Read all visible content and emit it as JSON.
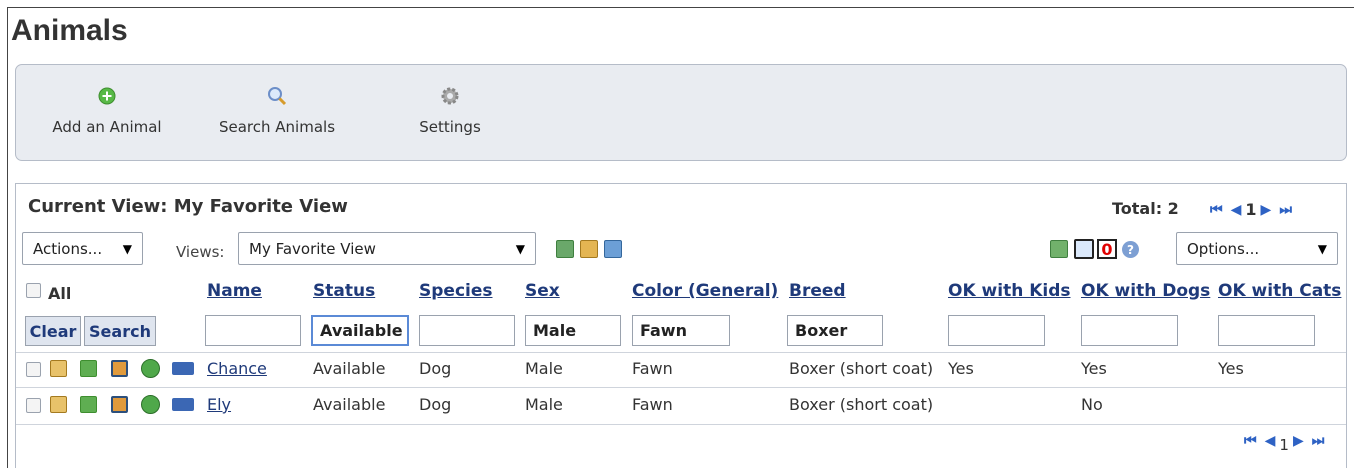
{
  "page": {
    "title": "Animals"
  },
  "toolbar": {
    "items": [
      {
        "label": "Add an Animal",
        "icon": "add-icon"
      },
      {
        "label": "Search Animals",
        "icon": "search-icon"
      },
      {
        "label": "Settings",
        "icon": "gear-icon"
      }
    ]
  },
  "view": {
    "title": "Current View: My Favorite View",
    "total_label": "Total: 2",
    "page_number": "1",
    "actions_label": "Actions...",
    "views_label": "Views:",
    "views_selected": "My Favorite View",
    "flag_count": "0",
    "options_label": "Options..."
  },
  "table": {
    "all_label": "All",
    "headers": [
      "Name",
      "Status",
      "Species",
      "Sex",
      "Color (General)",
      "Breed",
      "OK with Kids",
      "OK with Dogs",
      "OK with Cats"
    ],
    "filters": {
      "clear_label": "Clear",
      "search_label": "Search",
      "name": "",
      "status": "Available",
      "species": "",
      "sex": "Male",
      "color": "Fawn",
      "breed": "Boxer",
      "kids": "",
      "dogs": "",
      "cats": ""
    },
    "rows": [
      {
        "name": "Chance",
        "status": "Available",
        "species": "Dog",
        "sex": "Male",
        "color": "Fawn",
        "breed": "Boxer (short coat)",
        "kids": "Yes",
        "dogs": "Yes",
        "cats": "Yes"
      },
      {
        "name": "Ely",
        "status": "Available",
        "species": "Dog",
        "sex": "Male",
        "color": "Fawn",
        "breed": "Boxer (short coat)",
        "kids": "",
        "dogs": "No",
        "cats": ""
      }
    ]
  },
  "footer": {
    "page_number": "1"
  },
  "colors": {
    "link": "#1f3a7a",
    "accent": "#2e62c4",
    "toolbar_bg": "#e9ecf1",
    "alert": "#e00000"
  }
}
